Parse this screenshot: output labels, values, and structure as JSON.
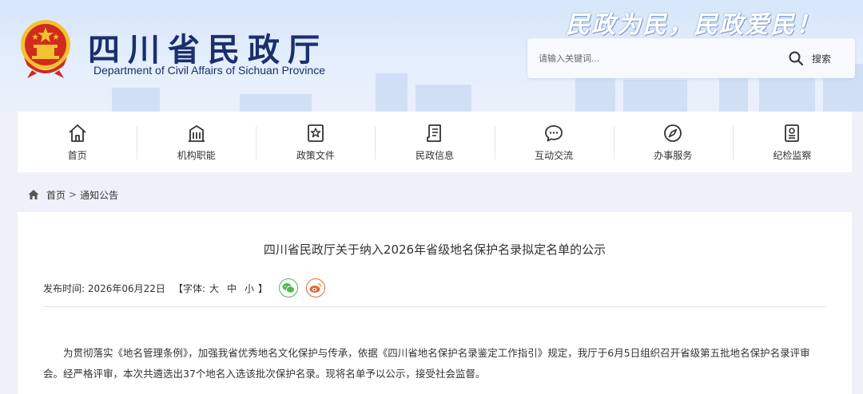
{
  "header": {
    "title": "四川省民政厅",
    "subtitle": "Department of Civil Affairs of Sichuan Province",
    "slogan": "民政为民，民政爱民！",
    "search": {
      "placeholder": "请输入关键词...",
      "button_label": "搜索"
    }
  },
  "nav": {
    "items": [
      {
        "label": "首页",
        "icon": "home-icon"
      },
      {
        "label": "机构职能",
        "icon": "building-icon"
      },
      {
        "label": "政策文件",
        "icon": "policy-star-icon"
      },
      {
        "label": "民政信息",
        "icon": "document-icon"
      },
      {
        "label": "互动交流",
        "icon": "chat-icon"
      },
      {
        "label": "办事服务",
        "icon": "compass-icon"
      },
      {
        "label": "纪检监察",
        "icon": "badge-icon"
      }
    ]
  },
  "breadcrumb": {
    "home": "首页",
    "separator": ">",
    "current": "通知公告"
  },
  "article": {
    "title": "四川省民政厅关于纳入2026年省级地名保护名录拟定名单的公示",
    "publish_label": "发布时间: 2026年06月22日",
    "font_size_open": "【字体:",
    "font_large": "大",
    "font_medium": "中",
    "font_small": "小",
    "font_size_close": "】",
    "body": "为贯彻落实《地名管理条例》，加强我省优秀地名文化保护与传承，依据《四川省地名保护名录鉴定工作指引》规定，我厅于6月5日组织召开省级第五批地名保护名录评审会。经严格评审，本次共遴选出37个地名入选该批次保护名录。现将名单予以公示，接受社会监督。"
  },
  "colors": {
    "title_blue": "#1b2f6e",
    "emblem_red": "#d32a1e",
    "emblem_gold": "#f2c230",
    "wechat_green": "#4db84e",
    "weibo_orange": "#e06a3a"
  }
}
